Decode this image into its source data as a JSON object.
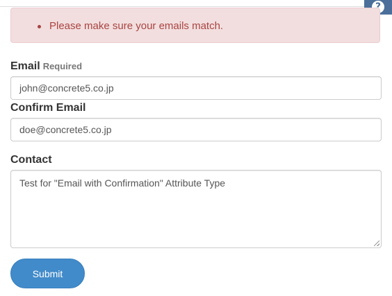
{
  "help": {
    "icon": "question-circle-icon",
    "glyph": "?"
  },
  "alert": {
    "message": "Please make sure your emails match.",
    "color": "#a94442",
    "background": "#f2dede"
  },
  "form": {
    "email": {
      "label": "Email",
      "required_label": "Required",
      "value": "john@concrete5.co.jp"
    },
    "confirm_email": {
      "label": "Confirm Email",
      "value": "doe@concrete5.co.jp"
    },
    "contact": {
      "label": "Contact",
      "value": "Test for \"Email with Confirmation\" Attribute Type"
    },
    "submit_label": "Submit",
    "accent_color": "#428bca"
  }
}
